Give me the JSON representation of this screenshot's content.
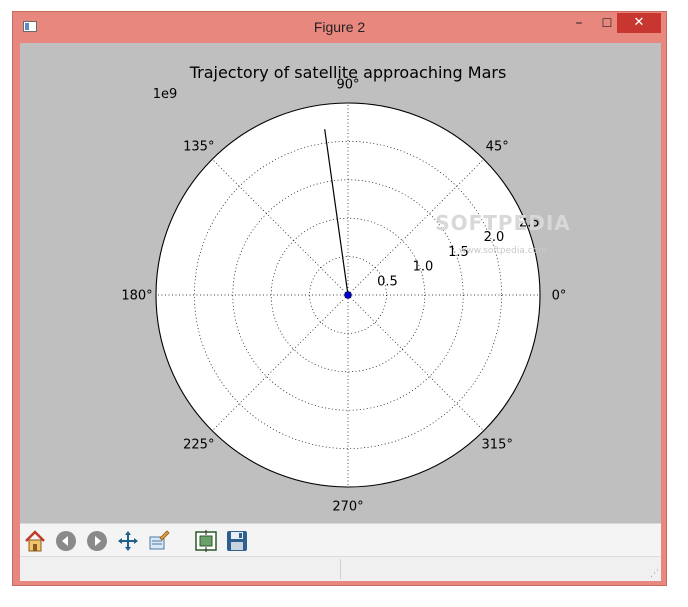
{
  "window": {
    "title": "Figure 2",
    "minimize": "–",
    "maximize": "☐",
    "close": "✕"
  },
  "chart_data": {
    "type": "line",
    "projection": "polar",
    "title": "Trajectory of satellite approaching Mars",
    "r_offset_label": "1e9",
    "theta_ticks": [
      "0°",
      "45°",
      "90°",
      "135°",
      "180°",
      "225°",
      "270°",
      "315°"
    ],
    "r_ticks": [
      "0.5",
      "1.0",
      "1.5",
      "2.0",
      "2.5"
    ],
    "r_max": 2.5,
    "grid": true,
    "series": [
      {
        "theta_deg": [
          90,
          98
        ],
        "r": [
          0,
          2.18
        ],
        "color": "#000000"
      }
    ],
    "center_marker": {
      "theta_deg": 0,
      "r": 0,
      "color": "#0000cc"
    }
  },
  "toolbar": {
    "items": [
      {
        "name": "home-button",
        "icon": "home-icon"
      },
      {
        "name": "back-button",
        "icon": "back-arrow-icon"
      },
      {
        "name": "forward-button",
        "icon": "forward-arrow-icon"
      },
      {
        "name": "pan-button",
        "icon": "move-icon"
      },
      {
        "name": "zoom-button",
        "icon": "zoom-rect-icon"
      },
      {
        "name": "subplots-button",
        "icon": "subplots-icon"
      },
      {
        "name": "save-button",
        "icon": "floppy-icon"
      }
    ]
  },
  "watermark": {
    "brand": "SOFTPEDIA",
    "site": "www.softpedia.com"
  }
}
